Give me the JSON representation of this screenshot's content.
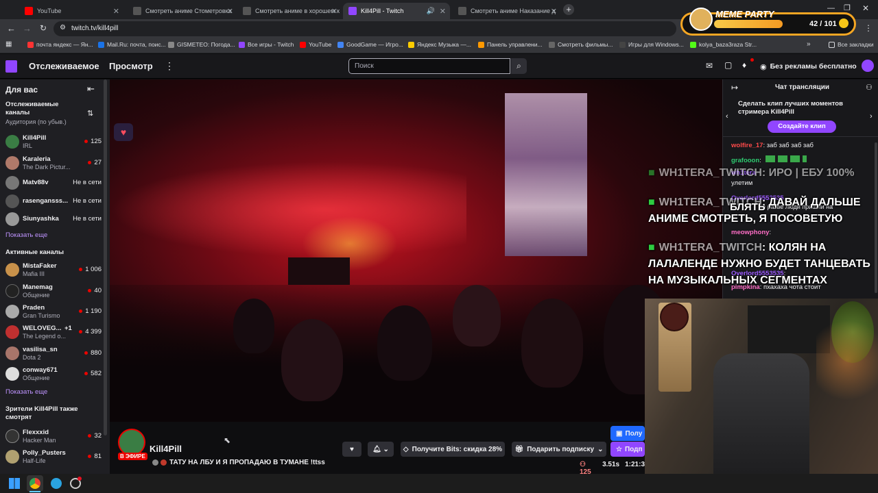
{
  "tabs": [
    {
      "label": "YouTube",
      "color": "#ff0000"
    },
    {
      "label": "Смотреть аниме Стометровка",
      "color": "#555"
    },
    {
      "label": "Смотреть аниме в хорошем к",
      "color": "#555"
    },
    {
      "label": "Kill4Pill - Twitch",
      "color": "#9146ff"
    },
    {
      "label": "Смотреть аниме Наказание д",
      "color": "#555"
    }
  ],
  "address": "twitch.tv/kill4pill",
  "meme_party": {
    "title": "MEME PARTY",
    "count": "42 / 101"
  },
  "bookmarks": [
    {
      "label": "почта яндекс — Ян...",
      "color": "#ff3333"
    },
    {
      "label": "Mail.Ru: почта, поис...",
      "color": "#1a73e8"
    },
    {
      "label": "GISMETEO: Погода...",
      "color": "#888"
    },
    {
      "label": "Все игры - Twitch",
      "color": "#9146ff"
    },
    {
      "label": "YouTube",
      "color": "#ff0000"
    },
    {
      "label": "GoodGame — Игро...",
      "color": "#4285f4"
    },
    {
      "label": "Яндекс Музыка —...",
      "color": "#ffcc00"
    },
    {
      "label": "Панель управлени...",
      "color": "#ff9900"
    },
    {
      "label": "Смотреть фильмы...",
      "color": "#666"
    },
    {
      "label": "Игры для Windows...",
      "color": "#444"
    },
    {
      "label": "kolya_baza3raza Str...",
      "color": "#53fc18"
    }
  ],
  "all_bookmarks": "Все закладки",
  "twitch": {
    "following": "Отслеживаемое",
    "browse": "Просмотр",
    "search_placeholder": "Поиск",
    "no_ads": "Без рекламы бесплатно"
  },
  "sidebar": {
    "for_you": "Для вас",
    "followed_title": "Отслеживаемые каналы",
    "followed_sort": "Аудитория (по убыв.)",
    "followed": [
      {
        "name": "Kill4Pill",
        "game": "IRL",
        "viewers": "125",
        "color": "#3a7d44"
      },
      {
        "name": "Karaleria",
        "game": "The Dark Pictur...",
        "viewers": "27",
        "color": "#b07a6a"
      },
      {
        "name": "Matv88v",
        "game": "",
        "offline": "Не в сети",
        "color": "#777"
      },
      {
        "name": "rasengansss...",
        "game": "",
        "offline": "Не в сети",
        "color": "#555"
      },
      {
        "name": "Siunyashka",
        "game": "",
        "offline": "Не в сети",
        "color": "#999"
      }
    ],
    "show_more_1": "Показать еще",
    "active_title": "Активные каналы",
    "active": [
      {
        "name": "MistaFaker",
        "game": "Mafia III",
        "viewers": "1 006",
        "color": "#c8914a"
      },
      {
        "name": "Manemag",
        "game": "Общение",
        "viewers": "40",
        "color": "#222"
      },
      {
        "name": "Praden",
        "game": "Gran Turismo",
        "viewers": "1 190",
        "color": "#aaa"
      },
      {
        "name": "WELOVEG...",
        "game": "The Legend o...",
        "viewers": "4 399",
        "extra": "+1",
        "color": "#c03030"
      },
      {
        "name": "vasilisa_sn",
        "game": "Dota 2",
        "viewers": "880",
        "color": "#a8756a"
      },
      {
        "name": "conway671",
        "game": "Общение",
        "viewers": "582",
        "color": "#ddd"
      }
    ],
    "show_more_2": "Показать еще",
    "also_title": "Зрители Kill4Pill также смотрят",
    "also": [
      {
        "name": "Flexxxid",
        "game": "Hacker Man",
        "viewers": "32",
        "color": "#333"
      },
      {
        "name": "Polly_Pusters",
        "game": "Half-Life",
        "viewers": "81",
        "color": "#b0a070"
      }
    ]
  },
  "stream": {
    "channel": "Kill4Pill",
    "live": "В ЭФИРЕ",
    "title": "ТАТУ НА ЛБУ И Я ПРОПАДАЮ В ТУМАНЕ !ttss",
    "bits": "Получите Bits: скидка 28%",
    "gift": "Подарить подписку",
    "sub": "Подп",
    "sub_top": "Полу",
    "viewers": "125",
    "latency": "3.51s",
    "uptime": "1:21:3"
  },
  "chat": {
    "title": "Чат трансляции",
    "banner_text": "Сделать клип лучших моментов стримера Kill4Pill",
    "banner_button": "Создайте клип",
    "messages": [
      {
        "user": "wolfire_17",
        "text": ": заб заб заб заб",
        "color": "#ff4a4a"
      },
      {
        "user": "grafooon",
        "text": ":",
        "color": "#2ecc71"
      },
      {
        "user": "wh1tera",
        "text": "улетим",
        "color": "#9b59ff"
      },
      {
        "user": "Overlord5553535",
        "text": "не разве люди пришли на",
        "color": "#9b59ff"
      },
      {
        "user": "meowphony",
        "text": ":",
        "color": "#ff6ec7"
      },
      {
        "user": "Overlord5553535",
        "text": ":",
        "color": "#9b59ff"
      },
      {
        "user": "pimpkina",
        "text": ": пхахаха чота стоит",
        "color": "#ff6ec7"
      }
    ]
  },
  "overlay": [
    {
      "user": "WH1TERA_TWITCH",
      "text": ": ИРО | ЕБУ 100%"
    },
    {
      "user": "WH1TERA_TWITCH",
      "text": ": ДАВАЙ ДАЛЬШЕ АНИМЕ СМОТРЕТЬ, Я ПОСОВЕТУЮ"
    },
    {
      "user": "WH1TERA_TWITCH",
      "text": ": КОЛЯН НА ЛАЛАЛЕНДЕ НУЖНО БУДЕТ ТАНЦЕВАТЬ НА МУЗЫКАЛЬНЫХ СЕГМЕНТАХ"
    }
  ],
  "overlay_extra": "БЛЯТЬ",
  "colors": {
    "twitch_purple": "#9146ff",
    "live_red": "#eb0400"
  }
}
